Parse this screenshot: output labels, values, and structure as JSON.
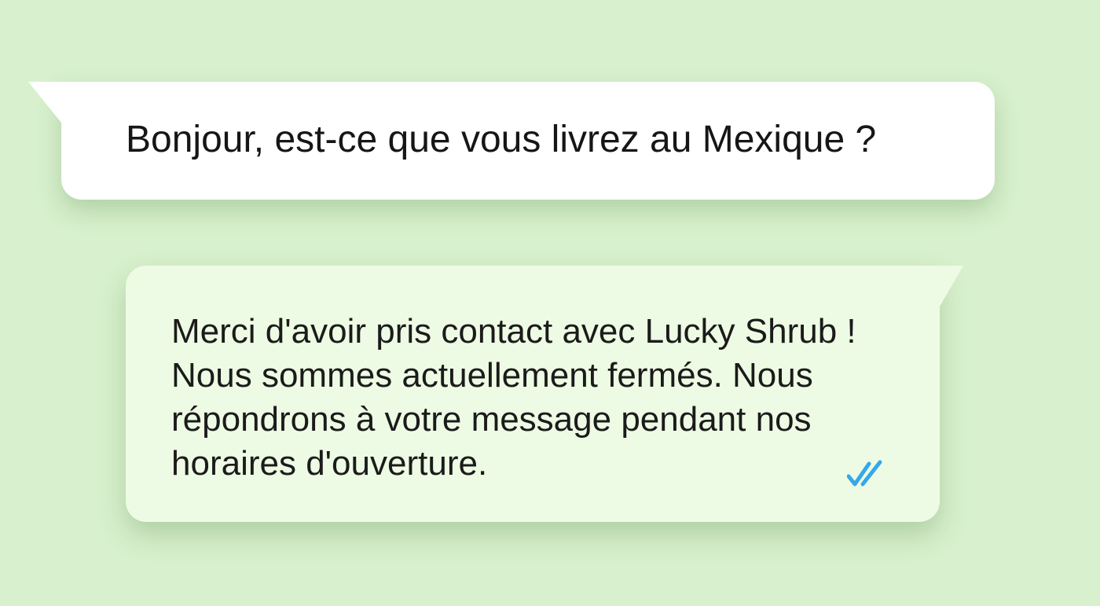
{
  "incoming_message": {
    "text": "Bonjour, est-ce que vous livrez au Mexique ?"
  },
  "outgoing_message": {
    "lines": [
      "Merci d'avoir pris contact avec Lucky Shrub !",
      "Nous sommes actuellement fermés. Nous",
      "répondrons à votre message pendant nos",
      "horaires d'ouverture."
    ],
    "status_icon": "double-check-icon"
  },
  "colors": {
    "background": "#d8f0cd",
    "incoming_bubble": "#ffffff",
    "outgoing_bubble": "#eefbe4",
    "read_tick": "#34a8ea"
  }
}
